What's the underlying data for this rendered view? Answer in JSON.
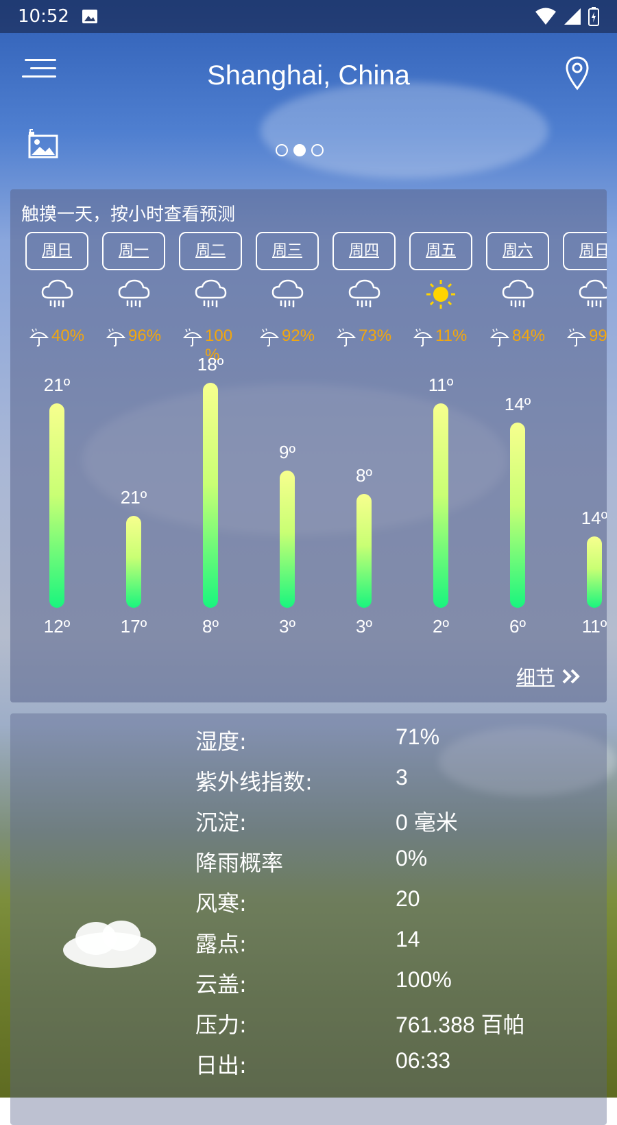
{
  "status_bar": {
    "time": "10:52"
  },
  "header": {
    "city": "Shanghai, China"
  },
  "pager": {
    "pages": 3,
    "active": 1
  },
  "forecast": {
    "hint": "触摸一天，按小时查看预测",
    "details_label": "细节",
    "days": [
      {
        "day": "周日",
        "icon": "rain-cloud-icon",
        "pop": "40%",
        "high": "21º",
        "low": "12º",
        "high_value": 21,
        "low_value": 12
      },
      {
        "day": "周一",
        "icon": "rain-cloud-icon",
        "pop": "96%",
        "high": "21º",
        "low": "17º",
        "high_value": 21,
        "low_value": 17
      },
      {
        "day": "周二",
        "icon": "rain-cloud-icon",
        "pop": "100 %",
        "high": "18º",
        "low": "8º",
        "high_value": 18,
        "low_value": 8
      },
      {
        "day": "周三",
        "icon": "rain-cloud-icon",
        "pop": "92%",
        "high": "9º",
        "low": "3º",
        "high_value": 9,
        "low_value": 3
      },
      {
        "day": "周四",
        "icon": "rain-cloud-icon",
        "pop": "73%",
        "high": "8º",
        "low": "3º",
        "high_value": 8,
        "low_value": 3
      },
      {
        "day": "周五",
        "icon": "sun-icon",
        "pop": "11%",
        "high": "11º",
        "low": "2º",
        "high_value": 11,
        "low_value": 2
      },
      {
        "day": "周六",
        "icon": "rain-cloud-icon",
        "pop": "84%",
        "high": "14º",
        "low": "6º",
        "high_value": 14,
        "low_value": 6
      },
      {
        "day": "周日",
        "icon": "rain-cloud-icon",
        "pop": "99",
        "high": "14º",
        "low": "11º",
        "high_value": 14,
        "low_value": 11
      }
    ]
  },
  "details": [
    {
      "label": "湿度:",
      "value": "71%"
    },
    {
      "label": "紫外线指数:",
      "value": "3"
    },
    {
      "label": "沉淀:",
      "value": "0 毫米"
    },
    {
      "label": "降雨概率",
      "value": "0%"
    },
    {
      "label": "风寒:",
      "value": "20"
    },
    {
      "label": "露点:",
      "value": "14"
    },
    {
      "label": "云盖:",
      "value": "100%"
    },
    {
      "label": "压力:",
      "value": "761.388 百帕"
    },
    {
      "label": "日出:",
      "value": "06:33"
    }
  ],
  "colors": {
    "pop": "#f3a70d",
    "bar_top": "#f7ff8e",
    "bar_bottom": "#19f57e"
  }
}
